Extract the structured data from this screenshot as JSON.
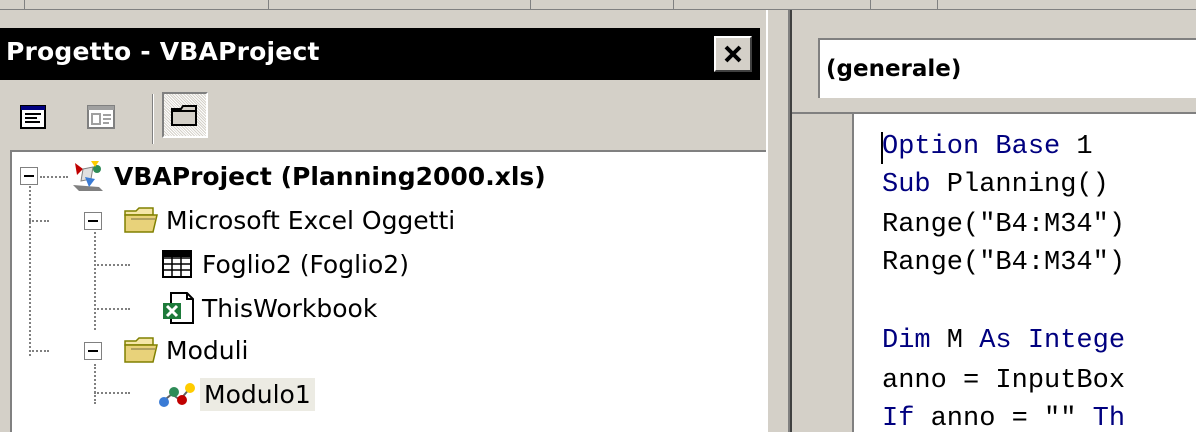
{
  "project_explorer": {
    "title": "Progetto - VBAProject",
    "close_label": "✕",
    "toolbar": {
      "view_code": "view-code",
      "view_object": "view-object",
      "toggle_folders": "toggle-folders"
    },
    "tree": {
      "root": {
        "label": "VBAProject (Planning2000.xls)",
        "icon": "vba-project-icon",
        "expanded": true
      },
      "groups": [
        {
          "label": "Microsoft Excel Oggetti",
          "icon": "folder-open-icon",
          "expanded": true,
          "items": [
            {
              "label": "Foglio2 (Foglio2)",
              "icon": "worksheet-icon"
            },
            {
              "label": "ThisWorkbook",
              "icon": "workbook-icon"
            }
          ]
        },
        {
          "label": "Moduli",
          "icon": "folder-open-icon",
          "expanded": true,
          "items": [
            {
              "label": "Modulo1",
              "icon": "module-icon",
              "selected": true
            }
          ]
        }
      ]
    }
  },
  "code_window": {
    "object_combo_value": "(generale)",
    "lines": [
      {
        "kw": "Option Base",
        "rest": " 1"
      },
      {
        "kw": "Sub",
        "rest": " Planning()"
      },
      {
        "kw": "",
        "rest": "Range(\"B4:M34\")"
      },
      {
        "kw": "",
        "rest": "Range(\"B4:M34\")"
      },
      {
        "kw": "",
        "rest": ""
      },
      {
        "kw": "Dim",
        "rest": " M ",
        "kw2": "As Intege"
      },
      {
        "kw": "",
        "rest": "anno = InputBox"
      },
      {
        "kw": "If",
        "rest": " anno = \"\" ",
        "kw2": "Th"
      }
    ]
  },
  "colors": {
    "title_bar": "#000000",
    "face": "#d4d0c8",
    "keyword": "#00007f",
    "selection": "#ecebe3"
  }
}
